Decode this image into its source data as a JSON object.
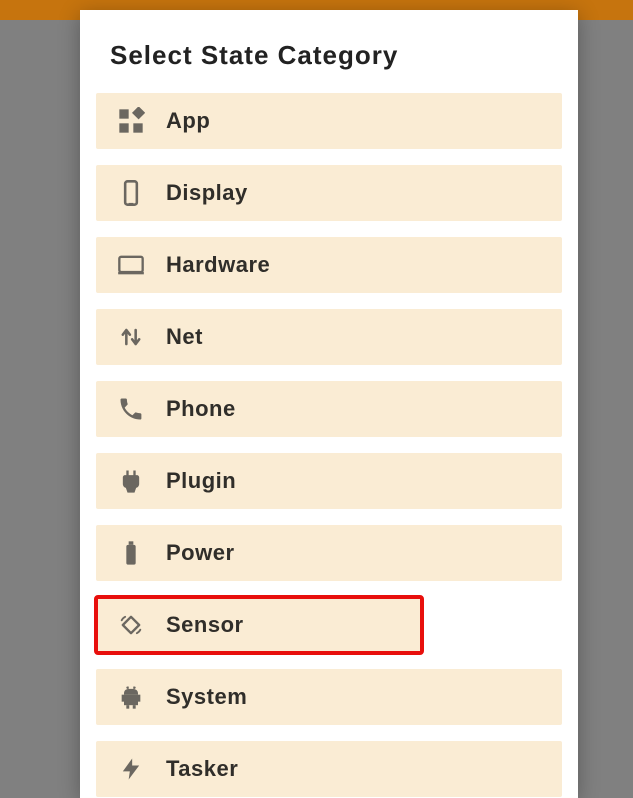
{
  "dialog": {
    "title": "Select State Category",
    "items": [
      {
        "label": "App"
      },
      {
        "label": "Display"
      },
      {
        "label": "Hardware"
      },
      {
        "label": "Net"
      },
      {
        "label": "Phone"
      },
      {
        "label": "Plugin"
      },
      {
        "label": "Power"
      },
      {
        "label": "Sensor"
      },
      {
        "label": "System"
      },
      {
        "label": "Tasker"
      }
    ]
  }
}
